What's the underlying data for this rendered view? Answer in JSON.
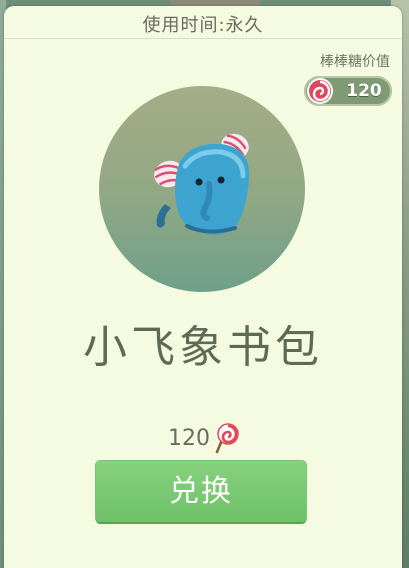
{
  "header": {
    "title": "使用时间:永久"
  },
  "value": {
    "label": "棒棒糖价值",
    "amount": "120",
    "icon": "lollipop-icon"
  },
  "item": {
    "name": "小飞象书包",
    "image": "blue-elephant-backpack"
  },
  "price": {
    "amount": "120",
    "icon": "lollipop-icon"
  },
  "actions": {
    "exchange_label": "兑换"
  },
  "colors": {
    "panel": "#f5fbe1",
    "button": "#7cc975",
    "text": "#5f6a55",
    "candy_red": "#d9404e"
  }
}
